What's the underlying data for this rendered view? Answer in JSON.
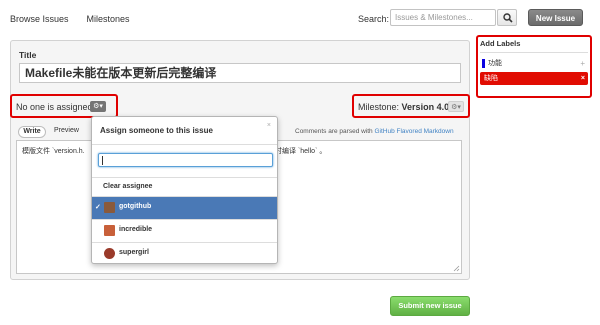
{
  "nav": {
    "browse_issues": "Browse Issues",
    "milestones": "Milestones"
  },
  "search": {
    "label": "Search:",
    "placeholder": "Issues & Milestones..."
  },
  "header": {
    "new_issue_label": "New Issue"
  },
  "form": {
    "title_label": "Title",
    "title_value": "Makefile未能在版本更新后完整编译",
    "assignee_text": "No one is assigned",
    "milestone_prefix": "Milestone:",
    "milestone_value": "Version 4.0",
    "tabs": {
      "write": "Write",
      "preview": "Preview"
    },
    "parsed_note": "Comments are parsed with",
    "parsed_link": "GitHub Flavored Markdown",
    "body_text_left": "模版文件 `version.h.",
    "body_text_right": "旧时编译 `hello` 。",
    "submit_label": "Submit new issue"
  },
  "labels_panel": {
    "heading": "Add Labels",
    "items": [
      {
        "name": "功能",
        "color": "#0b02e1",
        "action": "+",
        "selected": false
      },
      {
        "name": "缺陷",
        "color": "#e10c02",
        "action": "×",
        "selected": true
      }
    ]
  },
  "assign_popup": {
    "title": "Assign someone to this issue",
    "close": "×",
    "filter_value": "",
    "clear_label": "Clear assignee",
    "users": [
      {
        "name": "gotgithub",
        "selected": true,
        "avatar_color": "#8a5a3c"
      },
      {
        "name": "incredible",
        "selected": false,
        "avatar_color": "#c8603a"
      },
      {
        "name": "supergirl",
        "selected": false,
        "avatar_color": "#9a3a2a"
      }
    ],
    "check_mark": "✓"
  },
  "colors": {
    "highlight": "#e00000",
    "submit": "#60b044",
    "selected_row": "#4a79b6",
    "link": "#4183c4"
  }
}
